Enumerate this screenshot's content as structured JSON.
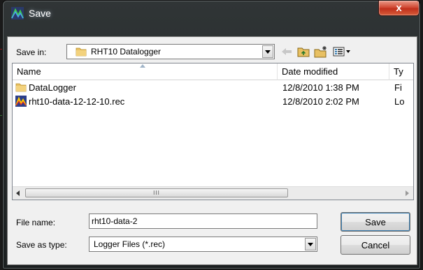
{
  "window": {
    "title": "Save",
    "close_glyph": "x"
  },
  "toolbar": {
    "save_in_label": "Save in:",
    "folder_name": "RHT10 Datalogger",
    "icons": [
      "back-arrow-icon",
      "up-folder-icon",
      "new-folder-icon",
      "view-menu-icon"
    ]
  },
  "file_list": {
    "columns": [
      "Name",
      "Date modified",
      "Ty"
    ],
    "rows": [
      {
        "name": "DataLogger",
        "date": "12/8/2010 1:38 PM",
        "type": "Fi",
        "icon": "folder-icon"
      },
      {
        "name": "rht10-data-12-12-10.rec",
        "date": "12/8/2010 2:02 PM",
        "type": "Lo",
        "icon": "rec-file-icon"
      }
    ],
    "scrollbar_grip": "III"
  },
  "form": {
    "file_name_label": "File name:",
    "file_name_value": "rht10-data-2",
    "save_as_type_label": "Save as type:",
    "save_as_type_value": "Logger Files (*.rec)"
  },
  "buttons": {
    "save": "Save",
    "cancel": "Cancel"
  },
  "colors": {
    "folder": "#e8c062",
    "accent_blue": "#3c7fb1",
    "close_red": "#c0301c"
  }
}
